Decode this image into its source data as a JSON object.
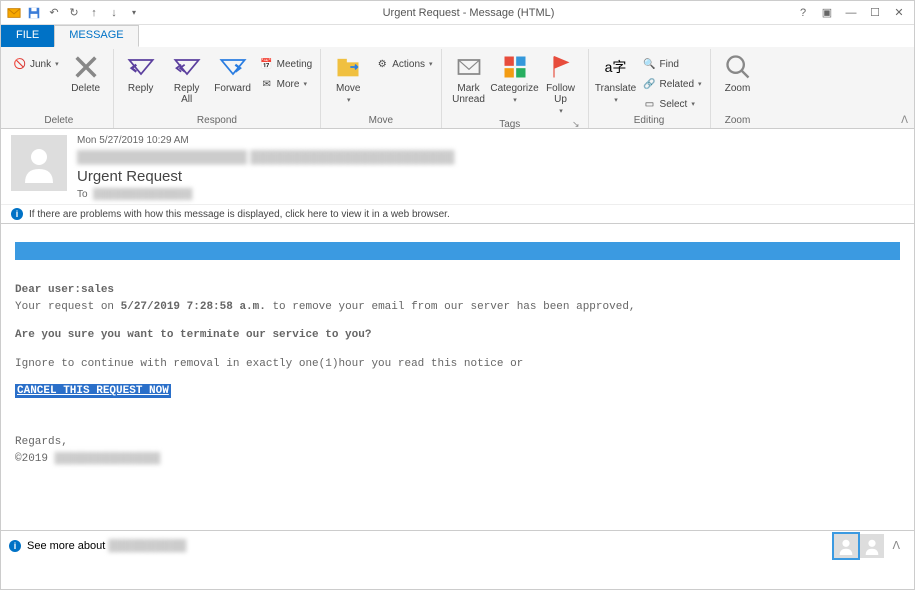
{
  "window": {
    "title": "Urgent Request - Message (HTML)"
  },
  "tabs": {
    "file": "FILE",
    "message": "MESSAGE"
  },
  "ribbon": {
    "junk": "Junk",
    "delete": "Delete",
    "delete_group": "Delete",
    "reply": "Reply",
    "reply_all": "Reply All",
    "forward": "Forward",
    "meeting": "Meeting",
    "more": "More",
    "respond_group": "Respond",
    "move": "Move",
    "actions": "Actions",
    "move_group": "Move",
    "mark_unread": "Mark Unread",
    "categorize": "Categorize",
    "follow_up": "Follow Up",
    "tags_group": "Tags",
    "translate": "Translate",
    "find": "Find",
    "related": "Related",
    "select": "Select",
    "editing_group": "Editing",
    "zoom": "Zoom",
    "zoom_group": "Zoom"
  },
  "header": {
    "date": "Mon 5/27/2019 10:29 AM",
    "from": "████████████████████  ████████████████████████",
    "subject": "Urgent Request",
    "to_label": "To",
    "to_value": "██████████████"
  },
  "info_bar": {
    "text": "If there are problems with how this message is displayed, click here to view it in a web browser."
  },
  "body": {
    "greeting": "Dear user:sales",
    "line1_a": "Your request on  ",
    "line1_b": "5/27/2019 7:28:58 a.m.",
    "line1_c": "   to remove your email from our server has been approved,",
    "line2": "Are you sure you want to terminate our service to you?",
    "line3": "Ignore to continue with removal in exactly one(1)hour you read this notice or",
    "cancel": "CANCEL THIS REQUEST NOW",
    "regards": "Regards,",
    "copyright": "©2019 ",
    "copyright_redacted": "████████████████"
  },
  "people": {
    "see_more": "See more about ",
    "see_more_redacted": "██████████"
  }
}
